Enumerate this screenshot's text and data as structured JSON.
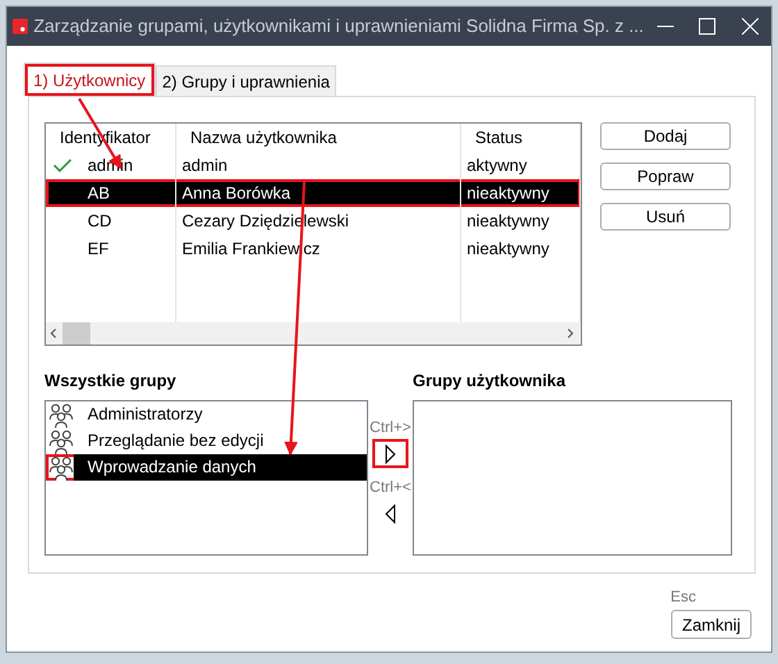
{
  "window": {
    "title": "Zarządzanie grupami, użytkownikami i uprawnieniami Solidna Firma Sp. z ..."
  },
  "tabs": [
    {
      "label": "1) Użytkownicy",
      "selected": true,
      "highlighted": true
    },
    {
      "label": "2) Grupy i uprawnienia",
      "selected": false,
      "highlighted": false
    }
  ],
  "users_table": {
    "columns": [
      "Identyfikator",
      "Nazwa użytkownika",
      "Status"
    ],
    "rows": [
      {
        "id": "admin",
        "name": "admin",
        "status": "aktywny",
        "checked": true,
        "selected": false,
        "highlighted": false
      },
      {
        "id": "AB",
        "name": "Anna Borówka",
        "status": "nieaktywny",
        "checked": false,
        "selected": true,
        "highlighted": true
      },
      {
        "id": "CD",
        "name": "Cezary Dziędzielewski",
        "status": "nieaktywny",
        "checked": false,
        "selected": false,
        "highlighted": false
      },
      {
        "id": "EF",
        "name": "Emilia Frankiewicz",
        "status": "nieaktywny",
        "checked": false,
        "selected": false,
        "highlighted": false
      }
    ]
  },
  "side_buttons": [
    "Dodaj",
    "Popraw",
    "Usuń"
  ],
  "all_groups": {
    "title": "Wszystkie grupy",
    "items": [
      {
        "label": "Administratorzy",
        "selected": false,
        "highlighted": false
      },
      {
        "label": "Przeglądanie bez edycji",
        "selected": false,
        "highlighted": false
      },
      {
        "label": "Wprowadzanie danych",
        "selected": true,
        "highlighted": true
      }
    ]
  },
  "move_buttons": [
    {
      "hint": "Ctrl+>",
      "kind": "right",
      "highlighted": true
    },
    {
      "hint": "Ctrl+<",
      "kind": "left",
      "highlighted": false
    }
  ],
  "user_groups": {
    "title": "Grupy użytkownika"
  },
  "close": {
    "hint": "Esc",
    "label": "Zamknij"
  }
}
